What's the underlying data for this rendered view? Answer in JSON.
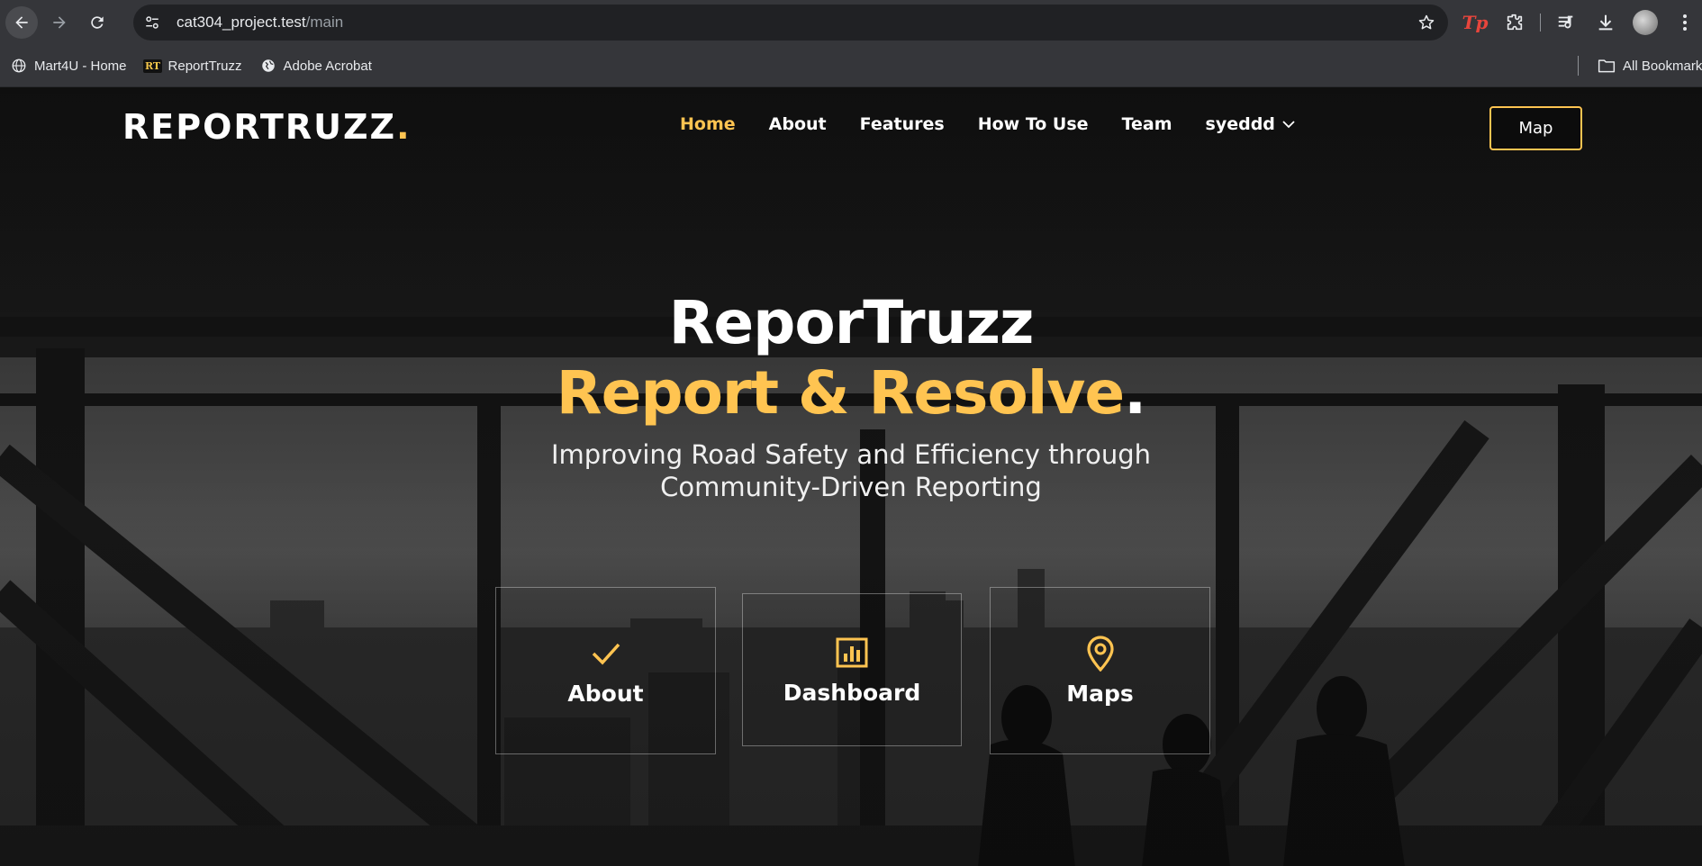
{
  "browser": {
    "url_host": "cat304_project.test",
    "url_path": "/main",
    "bookmarks": [
      {
        "label": "Mart4U - Home",
        "icon": "globe-icon"
      },
      {
        "label": "ReportTruzz",
        "icon": "rt-badge-icon",
        "badge": "RT"
      },
      {
        "label": "Adobe Acrobat",
        "icon": "globe-icon"
      }
    ],
    "all_bookmarks_label": "All Bookmarks",
    "extensions": [
      "tp-extension-icon",
      "extensions-puzzle-icon",
      "media-control-icon",
      "downloads-icon",
      "profile-avatar"
    ],
    "tp_label": "Tp"
  },
  "site": {
    "logo_text": "REPORTRUZZ",
    "logo_dot": ".",
    "nav": [
      {
        "label": "Home",
        "active": true
      },
      {
        "label": "About"
      },
      {
        "label": "Features"
      },
      {
        "label": "How To Use"
      },
      {
        "label": "Team"
      },
      {
        "label": "syeddd",
        "dropdown": true
      }
    ],
    "map_button": "Map"
  },
  "hero": {
    "title": "ReporTruzz",
    "tagline": "Report & Resolve",
    "tagline_dot": ".",
    "subtitle": "Improving Road Safety and Efficiency through Community-Driven Reporting"
  },
  "cards": [
    {
      "title": "About",
      "icon": "check-icon"
    },
    {
      "title": "Dashboard",
      "icon": "bar-chart-icon"
    },
    {
      "title": "Maps",
      "icon": "map-pin-icon"
    }
  ],
  "colors": {
    "accent": "#ffc451",
    "chrome": "#35363a",
    "omnibox": "#202124"
  }
}
